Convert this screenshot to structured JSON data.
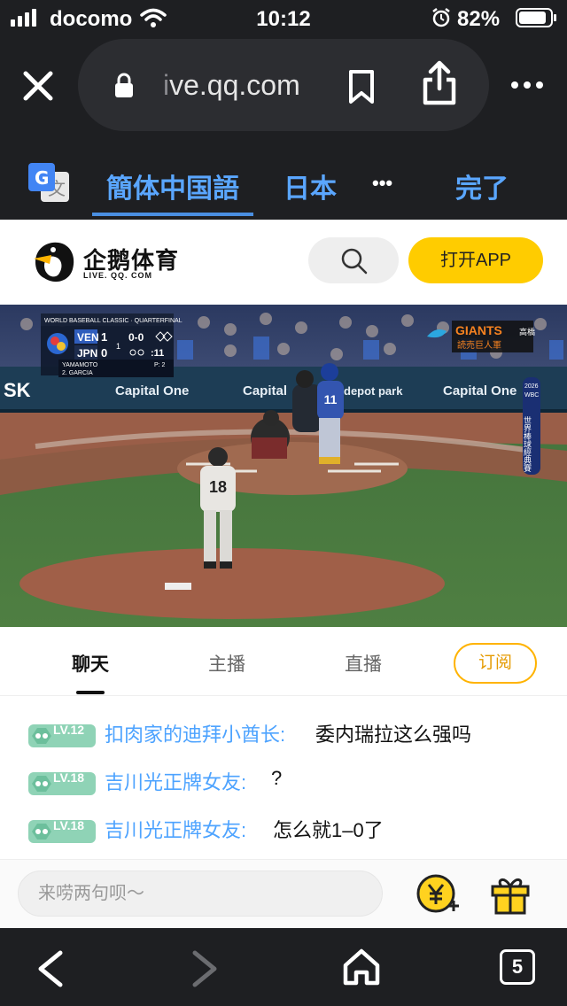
{
  "status_bar": {
    "carrier": "docomo",
    "time": "10:12",
    "battery": "82%"
  },
  "browser": {
    "url_faded": "i",
    "url": "ve.qq.com",
    "translate": {
      "source_lang": "簡体中国語",
      "target_lang": "日本",
      "more": "•••",
      "done": "完了"
    },
    "tab_count": "5"
  },
  "site": {
    "logo_name": "企鹅体育",
    "logo_sub": "LIVE. QQ. COM",
    "open_app": "打开APP"
  },
  "video": {
    "scorebug": {
      "event": "WORLD BASEBALL CLASSIC · QUARTERFINAL",
      "team1": "VEN",
      "score1": "1",
      "team2": "JPN",
      "score2": "0",
      "inning": "1",
      "count": "0-0",
      "time": ":11",
      "pitcher": "YAMAMOTO",
      "batter": "2. GARCIA",
      "pitches": "P: 2"
    },
    "giants_text": "GIANTS",
    "giants_sub": "読売巨人軍",
    "giants_side": "高橋",
    "board_ad1": "Capital One",
    "board_ad2": "Capital",
    "board_ad3": "Capital One",
    "board_ad4": "depot park",
    "board_sk": "SK",
    "side_banner": "世界棒球經典賽",
    "side_year": "2026",
    "side_wbc": "WBC",
    "pitcher_number": "18",
    "pitcher_name": "YAMAMOTO",
    "batter_number": "11"
  },
  "tabs": {
    "chat": "聊天",
    "host": "主播",
    "live": "直播",
    "subscribe": "订阅"
  },
  "chat": {
    "messages": [
      {
        "level": "LV.12",
        "user": "扣肉家的迪拜小酋长:",
        "text": "委内瑞拉这么强吗"
      },
      {
        "level": "LV.18",
        "user": "吉川光正牌女友:",
        "text": "?"
      },
      {
        "level": "LV.18",
        "user": "吉川光正牌女友:",
        "text": "怎么就1–0了"
      }
    ]
  },
  "input": {
    "placeholder": "来唠两句呗～"
  },
  "colors": {
    "accent_blue": "#4da3ff",
    "app_yellow": "#ffcc00",
    "badge_green": "#8fd3b6",
    "browser_dark": "#1e1f22"
  }
}
